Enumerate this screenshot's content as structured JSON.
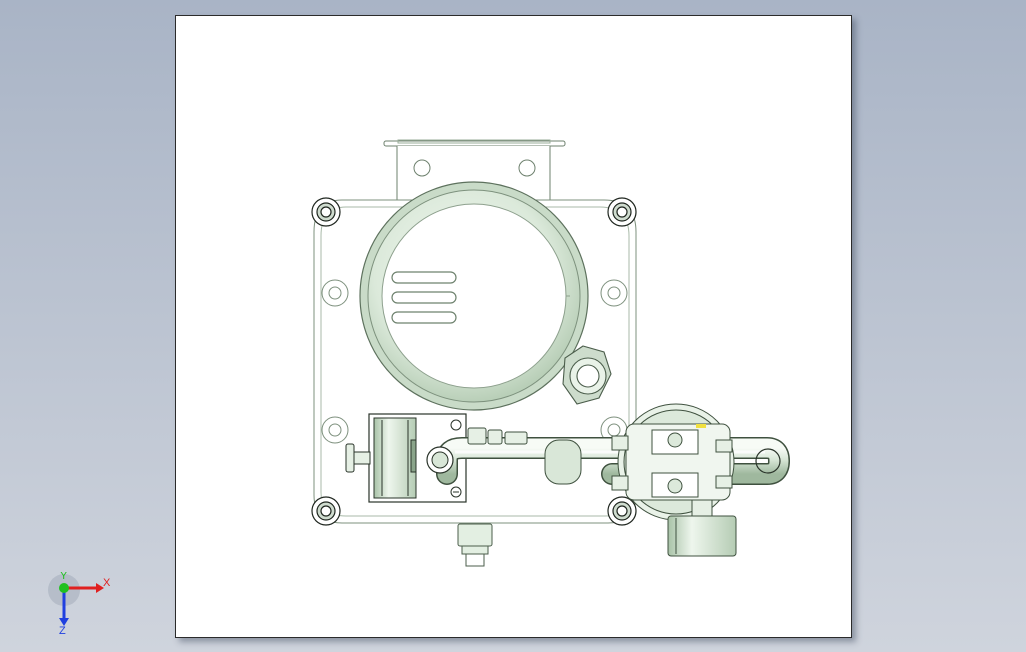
{
  "viewport": {
    "background_top": "#a9b4c6",
    "background_bottom": "#cfd4dd",
    "sheet_color": "#ffffff"
  },
  "model": {
    "line_color": "#3c4a3c",
    "part_fill": "#e3efe2",
    "part_shade": "#c3d7c2",
    "highlight_color": "#f0e040"
  },
  "triad": {
    "x_label": "X",
    "y_label": "Y",
    "z_label": "Z",
    "x_color": "#e02020",
    "y_color": "#20c020",
    "z_color": "#2040e0"
  }
}
